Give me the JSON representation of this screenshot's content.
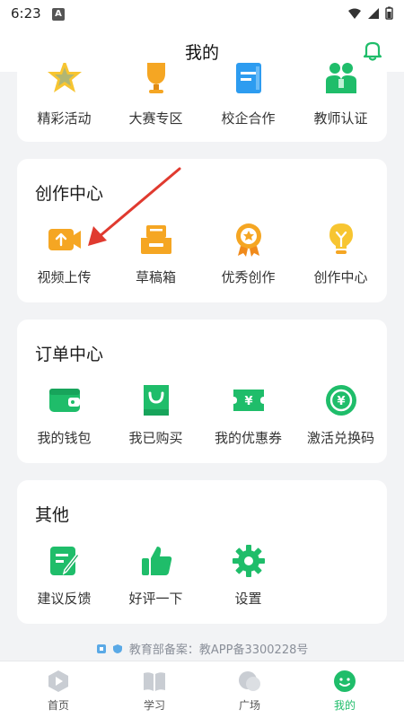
{
  "status_bar": {
    "time": "6:23",
    "app_letter": "A"
  },
  "header": {
    "title": "我的"
  },
  "cards": {
    "top": {
      "items": [
        {
          "label": "精彩活动",
          "icon": "star-icon"
        },
        {
          "label": "大赛专区",
          "icon": "trophy-icon"
        },
        {
          "label": "校企合作",
          "icon": "notebook-icon"
        },
        {
          "label": "教师认证",
          "icon": "teacher-icon"
        }
      ]
    },
    "creation": {
      "title": "创作中心",
      "items": [
        {
          "label": "视频上传",
          "icon": "video-upload-icon"
        },
        {
          "label": "草稿箱",
          "icon": "draft-box-icon"
        },
        {
          "label": "优秀创作",
          "icon": "award-icon"
        },
        {
          "label": "创作中心",
          "icon": "lightbulb-icon"
        }
      ]
    },
    "orders": {
      "title": "订单中心",
      "items": [
        {
          "label": "我的钱包",
          "icon": "wallet-icon"
        },
        {
          "label": "我已购买",
          "icon": "shopping-bag-icon"
        },
        {
          "label": "我的优惠券",
          "icon": "coupon-icon"
        },
        {
          "label": "激活兑换码",
          "icon": "redeem-code-icon"
        }
      ]
    },
    "other": {
      "title": "其他",
      "items": [
        {
          "label": "建议反馈",
          "icon": "feedback-icon"
        },
        {
          "label": "好评一下",
          "icon": "thumbs-up-icon"
        },
        {
          "label": "设置",
          "icon": "gear-icon"
        }
      ]
    }
  },
  "footer": {
    "registration": "教育部备案：教APP备3300228号"
  },
  "tabs": [
    {
      "label": "首页",
      "icon": "home-play-icon"
    },
    {
      "label": "学习",
      "icon": "book-icon"
    },
    {
      "label": "广场",
      "icon": "chat-bubbles-icon"
    },
    {
      "label": "我的",
      "icon": "profile-smile-icon",
      "active": true
    }
  ],
  "colors": {
    "accent_green": "#1fbd6a",
    "orange": "#f5a623",
    "blue": "#2d9cf0",
    "arrow_red": "#e03a2f"
  }
}
